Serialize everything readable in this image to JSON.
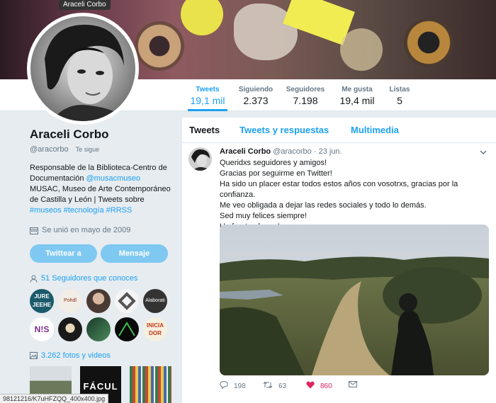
{
  "tooltip": "Araceli Corbo",
  "nav": {
    "stats": [
      {
        "label": "Tweets",
        "value": "19,1 mil"
      },
      {
        "label": "Siguiendo",
        "value": "2.373"
      },
      {
        "label": "Seguidores",
        "value": "7.198"
      },
      {
        "label": "Me gusta",
        "value": "19,4 mil"
      },
      {
        "label": "Listas",
        "value": "5"
      }
    ]
  },
  "profile": {
    "name": "Araceli Corbo",
    "handle": "@aracorbo",
    "follows_you": "Te sigue",
    "bio_1": "Responsable de la Biblioteca-Centro de Documentación ",
    "bio_link_1": "@musacmuseo",
    "bio_2": " MUSAC, Museo de Arte Contemporáneo de Castilla y León | Tweets sobre ",
    "bio_link_2": "#museos",
    "bio_3": " ",
    "bio_link_3": "#tecnología",
    "bio_4": " ",
    "bio_link_4": "#RRSS",
    "joined": "Se unió en mayo de 2009",
    "tweet_button": "Twittear a",
    "message_button": "Mensaje",
    "followers_you_know": "51 Seguidores que conoces",
    "photos_videos": "3.262 fotos y videos"
  },
  "tabs": [
    "Tweets",
    "Tweets y respuestas",
    "Multimedia"
  ],
  "tweet": {
    "name": "Araceli Corbo",
    "handle": "@aracorbo",
    "date": "· 23 jun.",
    "lines": [
      "Queridxs seguidores y amigos!",
      "Gracias por seguirme en Twitter!",
      "Ha sido un placer estar todos estos años con vosotrxs, gracias por la confianza.",
      "Me veo obligada a dejar las redes sociales y todo lo demás.",
      "Sed muy felices siempre!",
      "Un fuerte abrazo!"
    ],
    "replies": "198",
    "retweets": "63",
    "likes": "860"
  },
  "follower_thumbs": [
    {
      "text": "JURE\nJEEHE"
    },
    {
      "text": "Pohdl"
    },
    {
      "text": ""
    },
    {
      "text": ""
    },
    {
      "text": "Alaborati"
    },
    {
      "text": "N!S"
    },
    {
      "text": ""
    },
    {
      "text": ""
    },
    {
      "text": ""
    },
    {
      "text": "INICIA\nDOR"
    }
  ],
  "photo_thumbs": [
    {
      "text": ""
    },
    {
      "text": "FÁCUL"
    },
    {
      "text": ""
    }
  ],
  "status_url": "98121216/K7uHFZQQ_400x400.jpg",
  "colors": {
    "accent": "#1da1f2",
    "like": "#e0245e",
    "button": "#7fc8f2"
  }
}
